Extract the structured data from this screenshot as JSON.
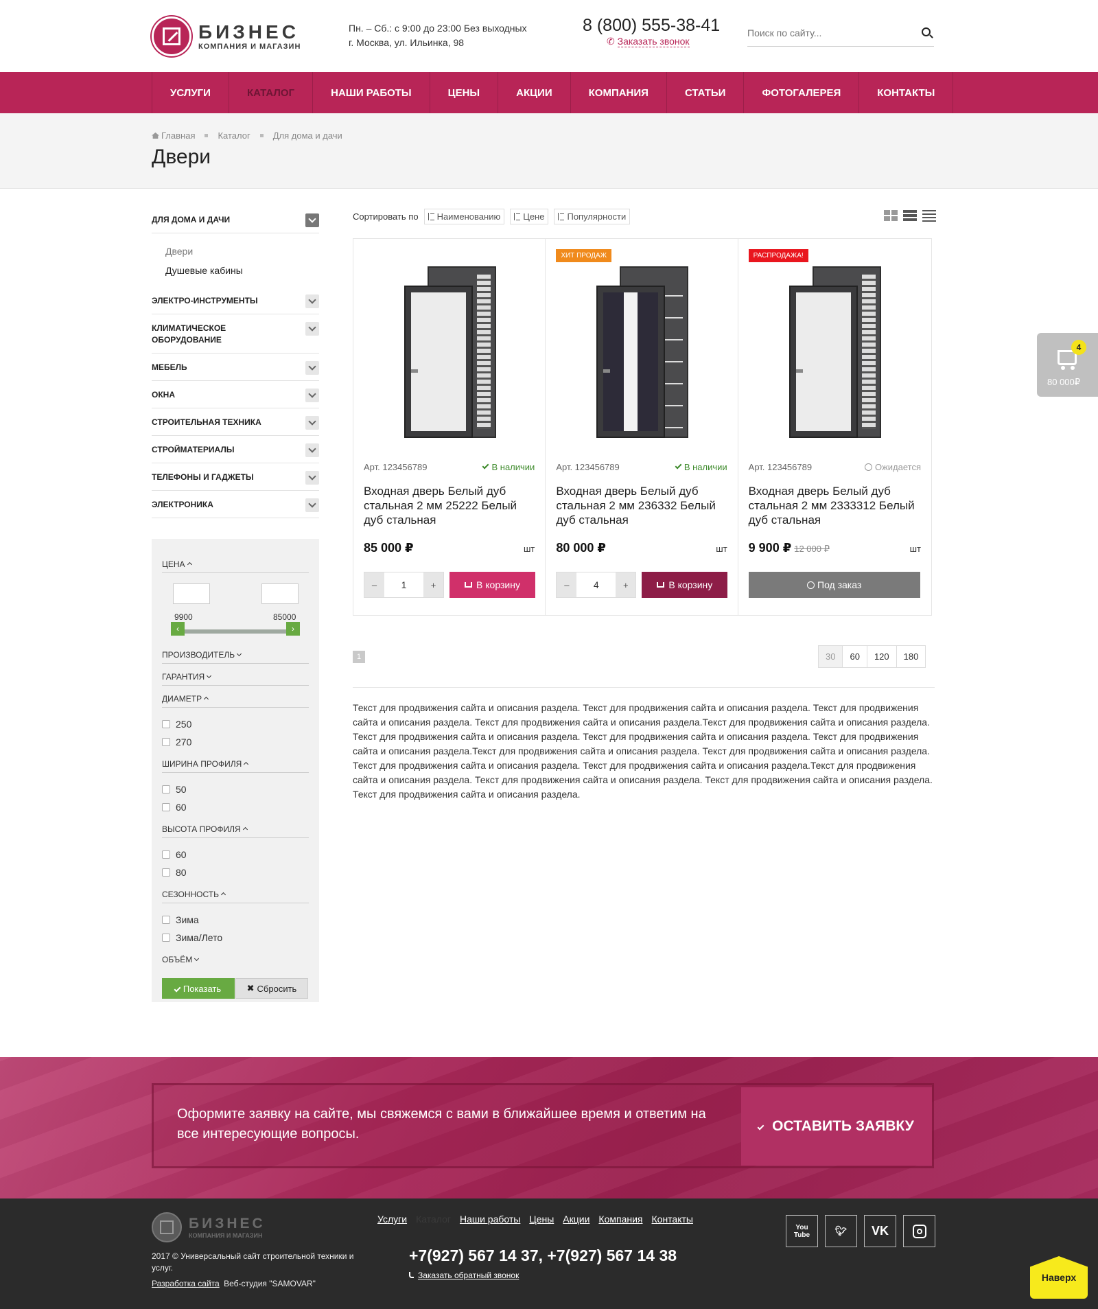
{
  "header": {
    "logo_title": "БИЗНЕС",
    "logo_subtitle": "КОМПАНИЯ И МАГАЗИН",
    "hours": "Пн. – Сб.: с 9:00 до 23:00 Без выходных",
    "address": "г. Москва, ул. Ильинка, 98",
    "phone": "8 (800) 555-38-41",
    "callback": "Заказать звонок",
    "search_placeholder": "Поиск по сайту..."
  },
  "nav": [
    "УСЛУГИ",
    "КАТАЛОГ",
    "НАШИ РАБОТЫ",
    "ЦЕНЫ",
    "АКЦИИ",
    "КОМПАНИЯ",
    "СТАТЬИ",
    "ФОТОГАЛЕРЕЯ",
    "КОНТАКТЫ"
  ],
  "breadcrumbs": [
    "Главная",
    "Каталог",
    "Для дома и дачи"
  ],
  "page_title": "Двери",
  "sidebar": {
    "categories": [
      {
        "label": "ДЛЯ ДОМА И ДАЧИ",
        "sub": [
          "Двери",
          "Душевые кабины"
        ]
      },
      {
        "label": "ЭЛЕКТРО-ИНСТРУМЕНТЫ"
      },
      {
        "label": "КЛИМАТИЧЕСКОЕ ОБОРУДОВАНИЕ"
      },
      {
        "label": "МЕБЕЛЬ"
      },
      {
        "label": "ОКНА"
      },
      {
        "label": "СТРОИТЕЛЬНАЯ ТЕХНИКА"
      },
      {
        "label": "СТРОЙМАТЕРИАЛЫ"
      },
      {
        "label": "ТЕЛЕФОНЫ И ГАДЖЕТЫ"
      },
      {
        "label": "ЭЛЕКТРОНИКА"
      }
    ]
  },
  "filter": {
    "price": "ЦЕНА",
    "price_min": "9900",
    "price_max": "85000",
    "manufacturer": "ПРОИЗВОДИТЕЛЬ",
    "warranty": "ГАРАНТИЯ",
    "diameter": "ДИАМЕТР",
    "diameter_options": [
      "250",
      "270"
    ],
    "width": "ШИРИНА ПРОФИЛЯ",
    "width_options": [
      "50",
      "60"
    ],
    "height": "ВЫСОТА ПРОФИЛЯ",
    "height_options": [
      "60",
      "80"
    ],
    "season": "СЕЗОННОСТЬ",
    "season_options": [
      "Зима",
      "Зима/Лето"
    ],
    "volume": "ОБЪЁМ",
    "show": "Показать",
    "reset": "Сбросить"
  },
  "sort": {
    "label": "Сортировать по",
    "by_name": "Наименованию",
    "by_price": "Цене",
    "by_popularity": "Популярности"
  },
  "products": [
    {
      "badge": "",
      "art": "Арт. 123456789",
      "stock": "В наличии",
      "title": "Входная дверь Белый дуб стальная 2 мм 25222 Белый дуб стальная",
      "price": "85 000 ₽",
      "old_price": "",
      "unit": "шт",
      "qty": "1",
      "button": "В корзину",
      "button_color": "#d0306a"
    },
    {
      "badge": "ХИТ ПРОДАЖ",
      "badge_color": "#f08a1c",
      "art": "Арт. 123456789",
      "stock": "В наличии",
      "title": "Входная дверь Белый дуб стальная 2 мм 236332 Белый дуб стальная",
      "price": "80 000 ₽",
      "old_price": "",
      "unit": "шт",
      "qty": "4",
      "button": "В корзину",
      "button_color": "#8d1d47"
    },
    {
      "badge": "РАСПРОДАЖА!",
      "badge_color": "#e9161e",
      "art": "Арт. 123456789",
      "stock": "Ожидается",
      "title": "Входная дверь Белый дуб стальная 2 мм 2333312 Белый дуб стальная",
      "price": "9 900 ₽",
      "old_price": "12 000 ₽",
      "unit": "шт",
      "button": "Под заказ"
    }
  ],
  "pagination": {
    "current": "1",
    "per_page": [
      "30",
      "60",
      "120",
      "180"
    ]
  },
  "seo_text": "Текст для продвижения сайта и описания раздела. Текст для продвижения сайта и описания раздела. Текст для продвижения сайта и описания раздела. Текст для продвижения сайта и описания раздела.Текст для продвижения сайта и описания раздела. Текст для продвижения сайта и описания раздела. Текст для продвижения сайта и описания раздела. Текст для продвижения сайта и описания раздела.Текст для продвижения сайта и описания раздела. Текст для продвижения сайта и описания раздела. Текст для продвижения сайта и описания раздела. Текст для продвижения сайта и описания раздела.Текст для продвижения сайта и описания раздела. Текст для продвижения сайта и описания раздела. Текст для продвижения сайта и описания раздела. Текст для продвижения сайта и описания раздела.",
  "cart": {
    "count": "4",
    "sum": "80 000₽"
  },
  "cta": {
    "text": "Оформите заявку на сайте, мы свяжемся с вами в ближайшее время и ответим на все интересующие вопросы.",
    "button": "ОСТАВИТЬ ЗАЯВКУ"
  },
  "footer": {
    "logo_title": "БИЗНЕС",
    "logo_subtitle": "КОМПАНИЯ И МАГАЗИН",
    "copyright": "2017 © Универсальный сайт строительной техники и услуг.",
    "dev_link": "Разработка сайта",
    "dev_name": "Веб-студия \"SAMOVAR\"",
    "menu": [
      "Услуги",
      "Каталог",
      "Наши работы",
      "Цены",
      "Акции",
      "Компания",
      "Контакты"
    ],
    "phones": "+7(927) 567 14 37, +7(927) 567 14 38",
    "callback": "Заказать обратный звонок",
    "social": [
      "You Tube",
      "twitter",
      "vk",
      "instagram"
    ],
    "to_top": "Наверх"
  }
}
